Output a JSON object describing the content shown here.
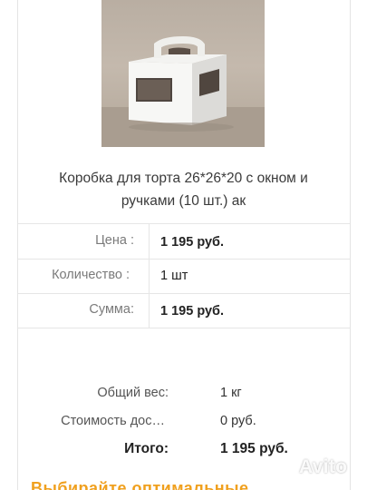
{
  "product": {
    "image_alt": "cake box photo",
    "title_line1": "Коробка для торта 26*26*20 с окном и",
    "title_line2": "ручками (10 шт.) ак"
  },
  "details": {
    "price_label": "Цена :",
    "price_value": "1 195 руб.",
    "qty_label": "Количество :",
    "qty_value": "1  шт",
    "sum_label": "Сумма:",
    "sum_value": "1 195 руб."
  },
  "summary": {
    "weight_label": "Общий вес:",
    "weight_value": "1 кг",
    "delivery_label": "Стоимость дос…",
    "delivery_value": "0 руб.",
    "total_label": "Итого:",
    "total_value": "1 195 руб."
  },
  "watermark": {
    "text": "Avito"
  },
  "footer": {
    "cut_text": "Выбирайте оптимальные"
  }
}
